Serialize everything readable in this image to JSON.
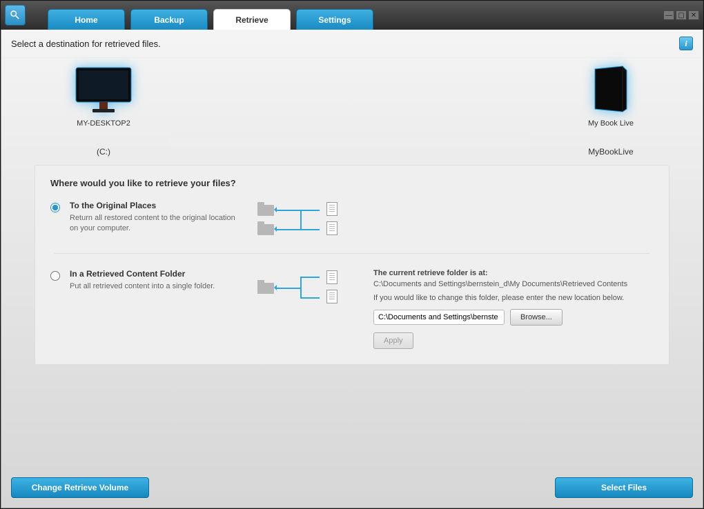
{
  "tabs": {
    "home": "Home",
    "backup": "Backup",
    "retrieve": "Retrieve",
    "settings": "Settings"
  },
  "instruction": "Select a destination for retrieved files.",
  "devices": {
    "local_name": "MY-DESKTOP2",
    "local_volume": "(C:)",
    "remote_name": "My Book Live",
    "remote_volume": "MyBookLive"
  },
  "panel": {
    "title": "Where would you like to retrieve your files?",
    "opt1_title": "To the Original Places",
    "opt1_desc": "Return all restored content to the original location on your computer.",
    "opt2_title": "In a Retrieved Content Folder",
    "opt2_desc": "Put all retrieved content into a single folder.",
    "rc_title": "The current retrieve folder is at:",
    "rc_path": "C:\\Documents and Settings\\bernstein_d\\My Documents\\Retrieved Contents",
    "rc_note": "If you would like to change this folder, please enter the new location below.",
    "path_value": "C:\\Documents and Settings\\bernste",
    "browse": "Browse...",
    "apply": "Apply"
  },
  "buttons": {
    "change_volume": "Change Retrieve Volume",
    "select_files": "Select Files"
  }
}
